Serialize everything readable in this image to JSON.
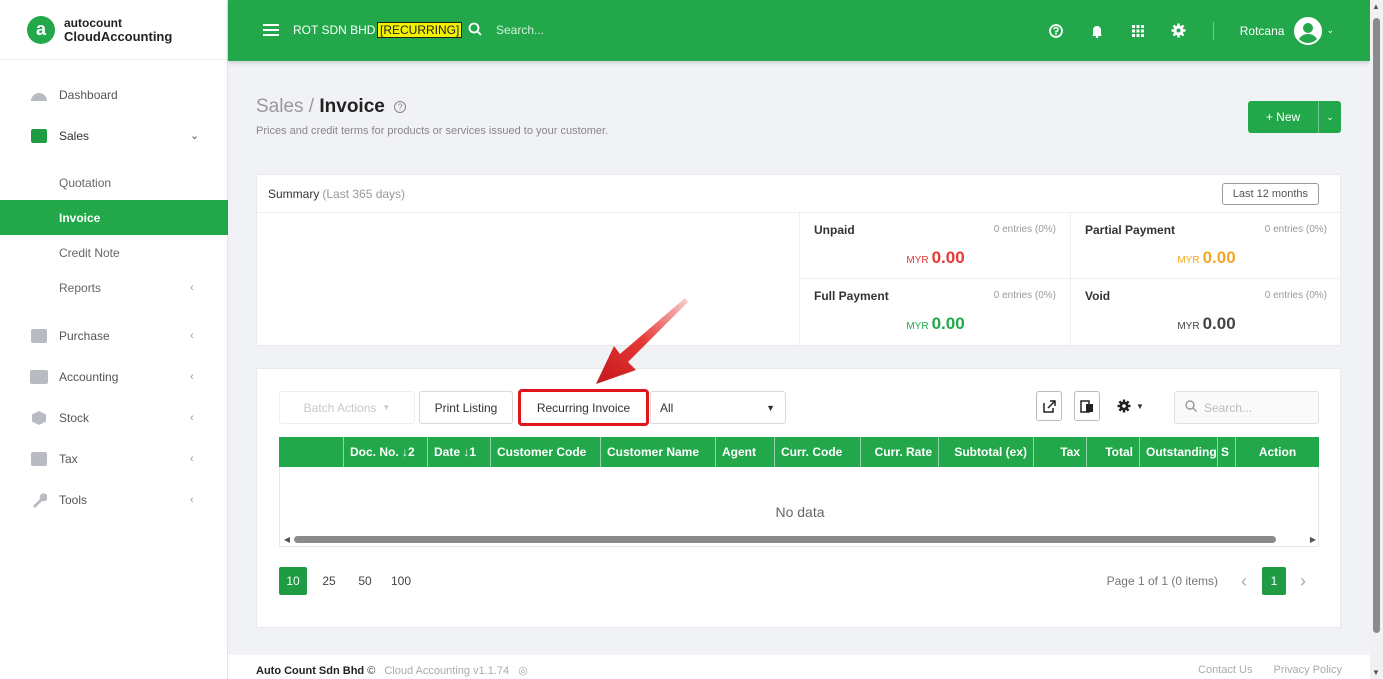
{
  "brand": {
    "top": "autocount",
    "bottom": "CloudAccounting",
    "logo_letter": "a"
  },
  "sidebar": {
    "items": [
      {
        "label": "Dashboard",
        "icon": "dashboard-icon"
      },
      {
        "label": "Sales",
        "icon": "sales-icon"
      },
      {
        "label": "Quotation"
      },
      {
        "label": "Invoice"
      },
      {
        "label": "Credit Note"
      },
      {
        "label": "Reports"
      },
      {
        "label": "Purchase",
        "icon": "purchase-icon"
      },
      {
        "label": "Accounting",
        "icon": "accounting-icon"
      },
      {
        "label": "Stock",
        "icon": "stock-icon"
      },
      {
        "label": "Tax",
        "icon": "tax-icon"
      },
      {
        "label": "Tools",
        "icon": "wrench-icon"
      }
    ]
  },
  "topbar": {
    "company": "ROT SDN BHD",
    "badge": "[RECURRING]",
    "search_placeholder": "Search...",
    "username": "Rotcana",
    "accent": "#22a84a"
  },
  "page": {
    "breadcrumb_parent": "Sales /",
    "title": "Invoice",
    "subtitle": "Prices and credit terms for products or services issued to your customer.",
    "new_label": "+ New"
  },
  "summary": {
    "title": "Summary",
    "period": "(Last 365 days)",
    "range_button": "Last 12 months",
    "stats": [
      {
        "title": "Unpaid",
        "entries": "0 entries (0%)",
        "currency": "MYR",
        "amount": "0.00",
        "color": "#e53935"
      },
      {
        "title": "Partial Payment",
        "entries": "0 entries (0%)",
        "currency": "MYR",
        "amount": "0.00",
        "color": "#f5a623"
      },
      {
        "title": "Full Payment",
        "entries": "0 entries (0%)",
        "currency": "MYR",
        "amount": "0.00",
        "color": "#22a84a"
      },
      {
        "title": "Void",
        "entries": "0 entries (0%)",
        "currency": "MYR",
        "amount": "0.00",
        "color": "#444444"
      }
    ]
  },
  "toolbar": {
    "batch_actions": "Batch Actions",
    "print_listing": "Print Listing",
    "recurring_invoice": "Recurring Invoice",
    "filter_value": "All",
    "search_placeholder": "Search..."
  },
  "table": {
    "columns": [
      "Doc. No. ↓2",
      "Date ↓1",
      "Customer Code",
      "Customer Name",
      "Agent",
      "Curr. Code",
      "Curr. Rate",
      "Subtotal (ex)",
      "Tax",
      "Total",
      "Outstanding",
      "S",
      "Action"
    ],
    "empty_text": "No data"
  },
  "pagination": {
    "sizes": [
      "10",
      "25",
      "50",
      "100"
    ],
    "active_size": "10",
    "info": "Page 1 of 1 (0 items)",
    "current_page": "1"
  },
  "footer": {
    "company": "Auto Count Sdn Bhd",
    "copyright": "©",
    "version": "Cloud Accounting v1.1.74",
    "links": [
      "Contact Us",
      "Privacy Policy"
    ]
  }
}
